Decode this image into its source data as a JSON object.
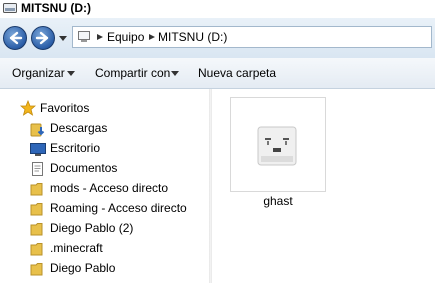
{
  "window": {
    "title": "MITSNU (D:)"
  },
  "address": {
    "segments": [
      "Equipo",
      "MITSNU (D:)"
    ]
  },
  "toolbar": {
    "organize": "Organizar",
    "share": "Compartir con",
    "new_folder": "Nueva carpeta"
  },
  "nav": {
    "favorites": "Favoritos",
    "items": [
      {
        "label": "Descargas",
        "icon": "downloads-folder-icon"
      },
      {
        "label": "Escritorio",
        "icon": "desktop-icon"
      },
      {
        "label": "Documentos",
        "icon": "documents-icon"
      },
      {
        "label": "mods - Acceso directo",
        "icon": "folder-icon"
      },
      {
        "label": "Roaming - Acceso directo",
        "icon": "folder-icon"
      },
      {
        "label": "Diego Pablo (2)",
        "icon": "folder-icon"
      },
      {
        "label": ".minecraft",
        "icon": "folder-icon"
      },
      {
        "label": "Diego Pablo",
        "icon": "folder-icon"
      }
    ]
  },
  "content": {
    "files": [
      {
        "name": "ghast",
        "icon": "ghast-image-icon"
      }
    ]
  },
  "colors": {
    "nav_button": "#2b5ea8",
    "folder": "#e8c04a",
    "star": "#f2b51c"
  }
}
